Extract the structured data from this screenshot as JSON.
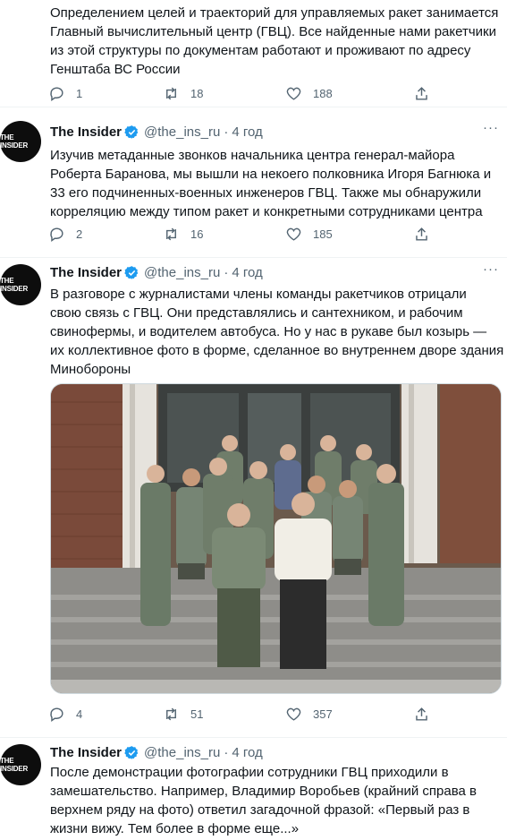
{
  "tweets": [
    {
      "author": null,
      "lines": [
        "Определением целей и траекторий для управляемых ракет занимается",
        "Главный вычислительный центр (ГВЦ). Все найденные нами ракетчики",
        "из этой структуры по документам работают и проживают по адресу",
        "Генштаба ВС России"
      ],
      "replies": "1",
      "retweets": "18",
      "likes": "188"
    },
    {
      "author": {
        "name": "The Insider",
        "handle": "@the_ins_ru",
        "sep": "·",
        "time": "4 год",
        "avatar_text": "THE INSIDER"
      },
      "lines": [
        "Изучив метаданные звонков начальника центра генерал-майора",
        "Роберта Баранова, мы вышли на некоего полковника Игоря Багнюка и",
        "33 его подчиненных-военных инженеров ГВЦ. Также мы обнаружили",
        "корреляцию между типом ракет и конкретными сотрудниками центра"
      ],
      "replies": "2",
      "retweets": "16",
      "likes": "185"
    },
    {
      "author": {
        "name": "The Insider",
        "handle": "@the_ins_ru",
        "sep": "·",
        "time": "4 год",
        "avatar_text": "THE INSIDER"
      },
      "lines": [
        "В разговоре с журналистами члены команды ракетчиков отрицали",
        "свою связь с ГВЦ. Они представлялись и сантехником, и рабочим",
        "свинофермы, и водителем автобуса. Но у нас в рукаве был козырь —",
        "их коллективное фото в форме, сделанное во внутреннем дворе здания",
        "Минобороны"
      ],
      "replies": "4",
      "retweets": "51",
      "likes": "357"
    },
    {
      "author": {
        "name": "The Insider",
        "handle": "@the_ins_ru",
        "sep": "·",
        "time": "4 год",
        "avatar_text": "THE INSIDER"
      },
      "lines": [
        "После демонстрации фотографии сотрудники ГВЦ приходили в",
        "замешательство. Например, Владимир Воробьев (крайний справа в",
        "верхнем ряду на фото) ответил загадочной фразой: «Первый раз в",
        "жизни вижу. Тем более в форме еще...»"
      ]
    }
  ],
  "colors": {
    "text": "#0f1419",
    "secondary": "#536471",
    "verified": "#1d9bf0",
    "divider": "#eff3f4"
  },
  "icons": [
    "reply-icon",
    "retweet-icon",
    "like-icon",
    "share-icon",
    "verified-badge-icon",
    "more-icon"
  ]
}
